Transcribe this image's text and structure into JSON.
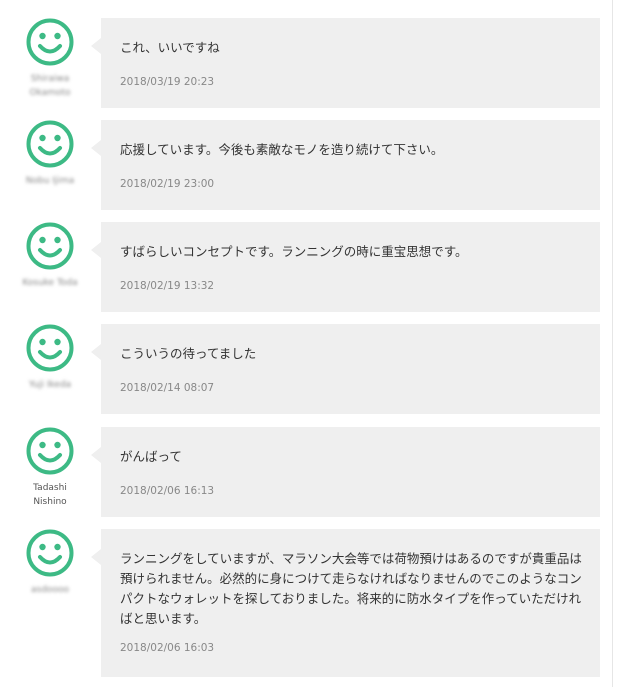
{
  "comments": [
    {
      "author": "Shiraiwa Okamoto",
      "author_blurred": true,
      "text": "これ、いいですね",
      "date": "2018/03/19 20:23"
    },
    {
      "author": "Nobu Ijima",
      "author_blurred": true,
      "text": "応援しています。今後も素敵なモノを造り続けて下さい。",
      "date": "2018/02/19 23:00"
    },
    {
      "author": "Kosuke Toda",
      "author_blurred": true,
      "text": "すばらしいコンセプトです。ランニングの時に重宝思想です。",
      "date": "2018/02/19 13:32"
    },
    {
      "author": "Yuji Ikeda",
      "author_blurred": true,
      "text": "こういうの待ってました",
      "date": "2018/02/14 08:07"
    },
    {
      "author": "Tadashi Nishino",
      "author_blurred": false,
      "text": "がんばって",
      "date": "2018/02/06 16:13"
    },
    {
      "author": "asdoooo",
      "author_blurred": true,
      "text": "ランニングをしていますが、マラソン大会等では荷物預けはあるのですが貴重品は預けられません。必然的に身につけて走らなければなりませんのでこのようなコンパクトなウォレットを探しておりました。将来的に防水タイプを作っていただければと思います。",
      "date": "2018/02/06 16:03"
    }
  ],
  "colors": {
    "avatar": "#3dba85",
    "bubble": "#efefef",
    "date": "#888888",
    "text": "#333333"
  },
  "icons": {
    "avatar": "smiley-face-icon"
  }
}
